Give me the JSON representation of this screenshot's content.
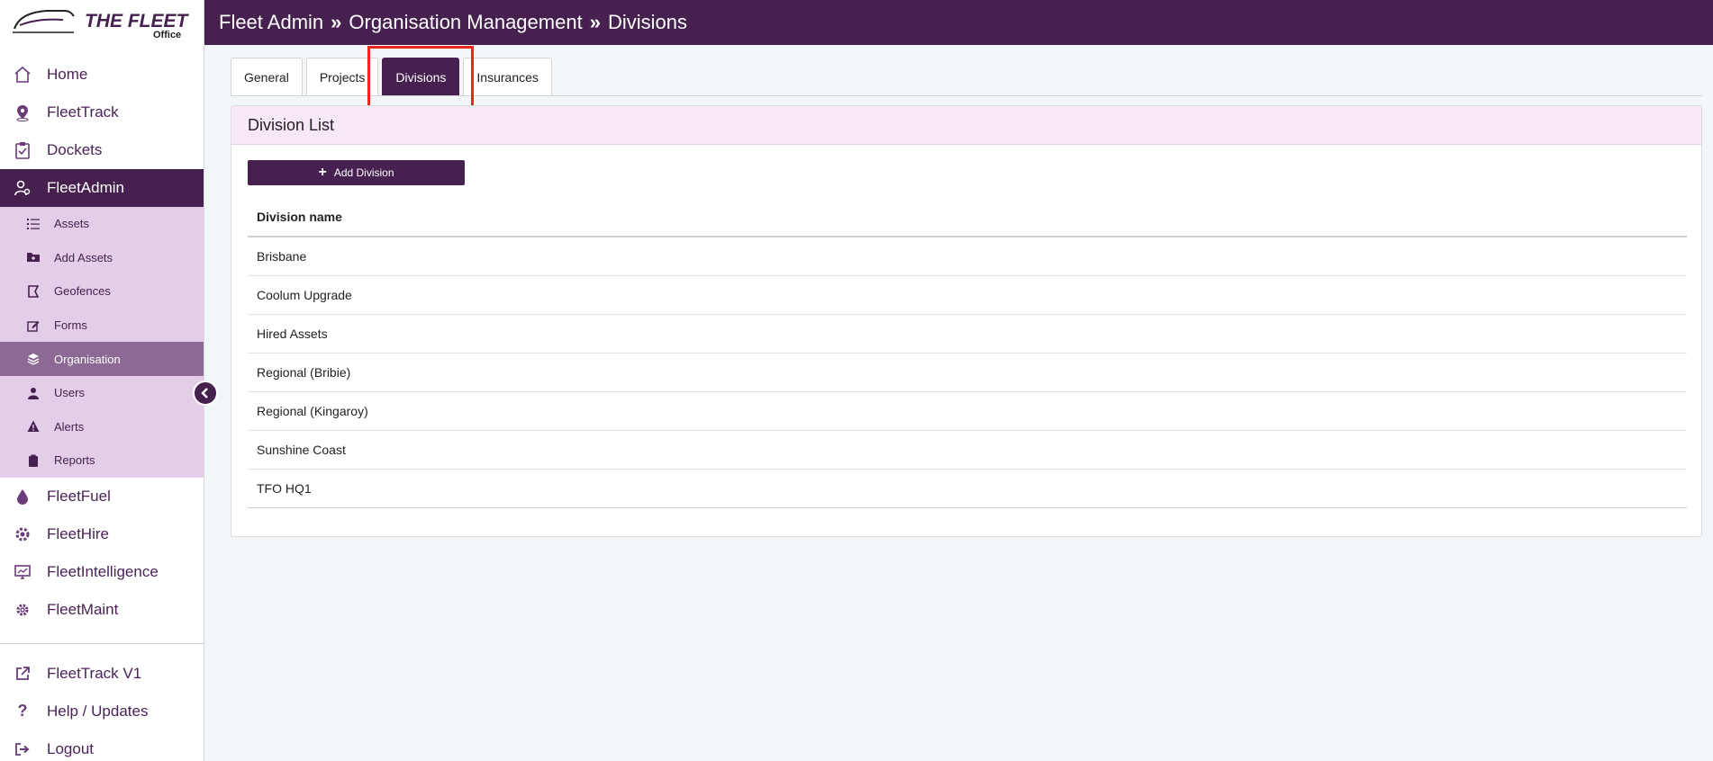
{
  "logo": {
    "line1": "THE FLEET",
    "line2": "Office"
  },
  "header": {
    "part1": "Fleet Admin",
    "sep": "»",
    "part2": "Organisation Management",
    "part3": "Divisions"
  },
  "nav": {
    "home": "Home",
    "fleettrack": "FleetTrack",
    "dockets": "Dockets",
    "fleetadmin": "FleetAdmin",
    "fleetfuel": "FleetFuel",
    "fleethire": "FleetHire",
    "fleetintelligence": "FleetIntelligence",
    "fleetmaint": "FleetMaint",
    "fleettrack_v1": "FleetTrack V1",
    "help": "Help / Updates",
    "logout": "Logout"
  },
  "subnav": {
    "assets": "Assets",
    "add_assets": "Add Assets",
    "geofences": "Geofences",
    "forms": "Forms",
    "organisation": "Organisation",
    "users": "Users",
    "alerts": "Alerts",
    "reports": "Reports"
  },
  "tabs": {
    "general": "General",
    "projects": "Projects",
    "divisions": "Divisions",
    "insurances": "Insurances"
  },
  "card": {
    "title": "Division List",
    "add_button": "Add Division",
    "column_header": "Division name",
    "rows": [
      "Brisbane",
      "Coolum Upgrade",
      "Hired Assets",
      "Regional (Bribie)",
      "Regional (Kingaroy)",
      "Sunshine Coast",
      "TFO HQ1"
    ]
  },
  "colors": {
    "brand": "#46204f",
    "subnav_bg": "#e3cde8",
    "highlight": "#e8281c"
  }
}
